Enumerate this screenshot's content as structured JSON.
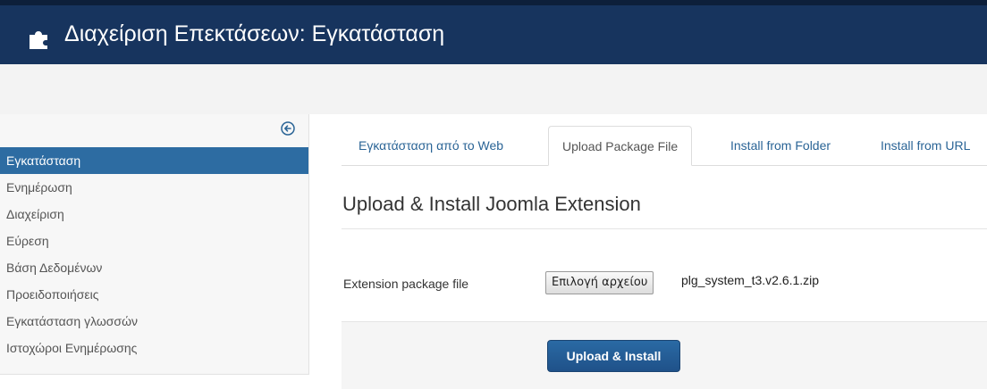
{
  "header": {
    "title": "Διαχείριση Επεκτάσεων: Εγκατάσταση",
    "icon": "puzzle-icon",
    "background": "#17345e"
  },
  "sidebar": {
    "toggle_icon": "collapse-arrow-icon",
    "items": [
      {
        "label": "Εγκατάσταση",
        "active": true
      },
      {
        "label": "Ενημέρωση",
        "active": false
      },
      {
        "label": "Διαχείριση",
        "active": false
      },
      {
        "label": "Εύρεση",
        "active": false
      },
      {
        "label": "Βάση Δεδομένων",
        "active": false
      },
      {
        "label": "Προειδοποιήσεις",
        "active": false
      },
      {
        "label": "Εγκατάσταση γλωσσών",
        "active": false
      },
      {
        "label": "Ιστοχώροι Ενημέρωσης",
        "active": false
      }
    ],
    "active_color": "#2d6ca2"
  },
  "tabs": [
    {
      "label": "Εγκατάσταση από το Web",
      "active": false
    },
    {
      "label": "Upload Package File",
      "active": true
    },
    {
      "label": "Install from Folder",
      "active": false
    },
    {
      "label": "Install from URL",
      "active": false
    }
  ],
  "main": {
    "section_title": "Upload & Install Joomla Extension",
    "field_label": "Extension package file",
    "file_button_label": "Επιλογή αρχείου",
    "file_name": "plg_system_t3.v2.6.1.zip",
    "install_button_label": "Upload & Install"
  }
}
